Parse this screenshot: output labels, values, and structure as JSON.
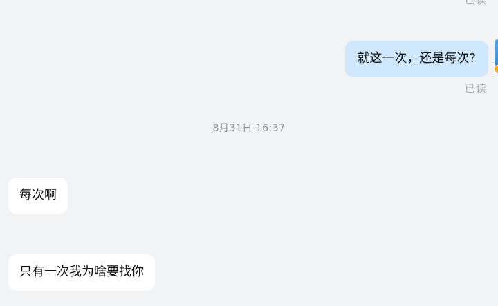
{
  "messages": {
    "top_read_status": "已读",
    "outgoing_text": "就这一次，还是每次?",
    "outgoing_read_status": "已读",
    "timestamp": "8月31日 16:37",
    "incoming": [
      {
        "text": "每次啊"
      },
      {
        "text": "只有一次我为啥要找你"
      }
    ]
  },
  "colors": {
    "background": "#f2f3f5",
    "outgoing_bubble": "#cfe8fd",
    "incoming_bubble": "#ffffff",
    "meta_text": "#a7aab1",
    "timestamp_text": "#8e9199"
  },
  "icons": {
    "avatar": "avatar-icon",
    "badge": "verified-badge-icon"
  }
}
